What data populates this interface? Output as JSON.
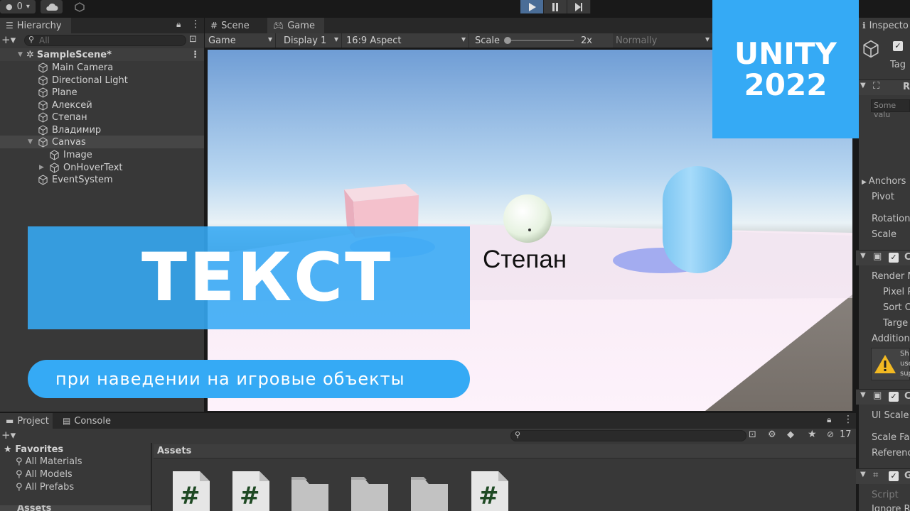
{
  "toolbar": {
    "account_label": "0",
    "play_tooltip": "play",
    "pause_tooltip": "pause",
    "step_tooltip": "step"
  },
  "hierarchy": {
    "tab_label": "Hierarchy",
    "search_placeholder": "All",
    "scene_name": "SampleScene*",
    "items": [
      {
        "label": "Main Camera",
        "depth": 1
      },
      {
        "label": "Directional Light",
        "depth": 1
      },
      {
        "label": "Plane",
        "depth": 1
      },
      {
        "label": "Алексей",
        "depth": 1
      },
      {
        "label": "Степан",
        "depth": 1
      },
      {
        "label": "Владимир",
        "depth": 1
      },
      {
        "label": "Canvas",
        "depth": 1,
        "expanded": true
      },
      {
        "label": "Image",
        "depth": 2
      },
      {
        "label": "OnHoverText",
        "depth": 2,
        "collapsed": true
      },
      {
        "label": "EventSystem",
        "depth": 1
      }
    ]
  },
  "view_tabs": {
    "scene_label": "Scene",
    "game_label": "Game"
  },
  "game_controls": {
    "mode": "Game",
    "display": "Display 1",
    "aspect": "16:9 Aspect",
    "scale_label": "Scale",
    "scale_value": "2x",
    "play_mode": "Normally"
  },
  "game_view": {
    "hover_text": "Степан"
  },
  "project": {
    "project_tab": "Project",
    "console_tab": "Console",
    "favorites_label": "Favorites",
    "favorites": [
      "All Materials",
      "All Models",
      "All Prefabs"
    ],
    "assets_header": "Assets",
    "assets_tree_label": "Assets",
    "hidden_count": "17",
    "asset_icons": [
      "script-icon",
      "script-icon",
      "folder-icon",
      "folder-icon",
      "folder-icon",
      "script-icon"
    ]
  },
  "inspector": {
    "tab_label": "Inspecto",
    "tag_label": "Tag",
    "some_value": "Some valu",
    "r_label": "R",
    "anchors": "Anchors",
    "pivot": "Pivot",
    "rotation": "Rotation",
    "scale": "Scale",
    "c1": "C",
    "render_mode": "Render M",
    "pixel_perfect": "Pixel P",
    "sort_order": "Sort O",
    "target": "Targe",
    "additional": "Additiona",
    "warning_lines": [
      "Sh",
      "use",
      "sup"
    ],
    "c2": "C",
    "ui_scale": "UI Scale",
    "scale_factor": "Scale Fa",
    "reference": "Referenc",
    "g_label": "G",
    "script": "Script",
    "ignore": "Ignore R"
  },
  "overlay": {
    "title": "ТЕКСТ",
    "subtitle": "при наведении на игровые объекты",
    "badge_line1": "UNITY",
    "badge_line2": "2022"
  },
  "colors": {
    "accent": "#35aaf5",
    "editor_bg": "#383838",
    "tab_bg": "#282828"
  }
}
